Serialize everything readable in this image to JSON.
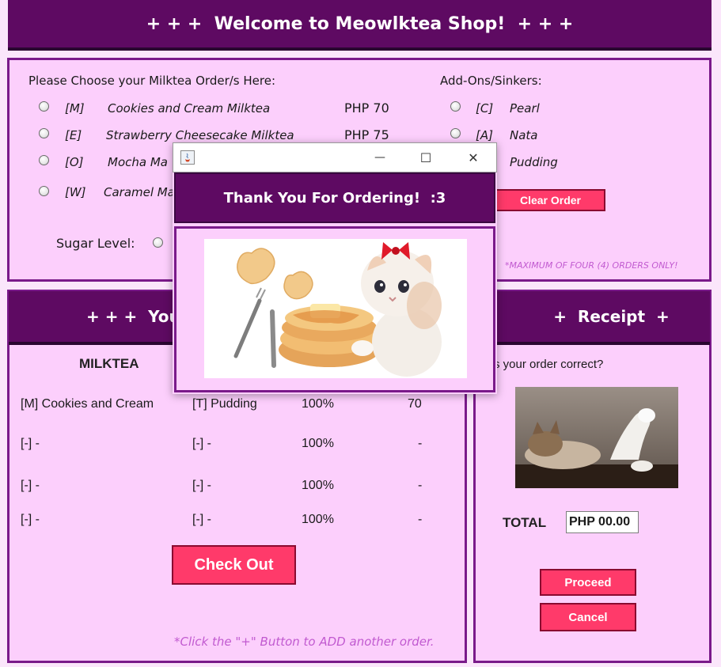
{
  "window_title": "+ + +  Welcome to Meowlktea Shop!  + + +",
  "order": {
    "heading": "Please Choose your Milktea Order/s Here:",
    "items": [
      {
        "code": "[M]",
        "name": "Cookies and Cream Milktea",
        "price": "PHP 70"
      },
      {
        "code": "[E]",
        "name": "Strawberry Cheesecake Milktea",
        "price": "PHP 75"
      },
      {
        "code": "[O]",
        "name": "Mocha Ma",
        "price": ""
      },
      {
        "code": "[W]",
        "name": "Caramel Ma",
        "price": ""
      }
    ],
    "sugar_label": "Sugar Level:"
  },
  "addons": {
    "heading": "Add-Ons/Sinkers:",
    "items": [
      {
        "code": "[C]",
        "name": "Pearl"
      },
      {
        "code": "[A]",
        "name": "Nata"
      },
      {
        "code": "",
        "name": "Pudding"
      }
    ],
    "clear_label": "Clear Order",
    "max_note": "*MAXIMUM OF FOUR (4) ORDERS ONLY!"
  },
  "your_order": {
    "header": "+ + +  Your",
    "col_milktea": "MILKTEA",
    "rows": [
      {
        "milktea": "[M] Cookies and Cream",
        "addon": "[T] Pudding",
        "sugar": "100%",
        "price": "70"
      },
      {
        "milktea": "[-] -",
        "addon": "[-] -",
        "sugar": "100%",
        "price": "-"
      },
      {
        "milktea": "[-] -",
        "addon": "[-] -",
        "sugar": "100%",
        "price": "-"
      },
      {
        "milktea": "[-] -",
        "addon": "[-] -",
        "sugar": "100%",
        "price": "-"
      }
    ],
    "checkout_label": "Check Out",
    "add_note": "*Click the \"+\" Button to ADD another order."
  },
  "receipt": {
    "header": "+  Receipt  +",
    "question": "s your order correct?",
    "total_label": "TOTAL",
    "total_value": "PHP 00.00",
    "proceed_label": "Proceed",
    "cancel_label": "Cancel"
  },
  "dialog": {
    "banner": "Thank You For Ordering!  :3",
    "minimize_glyph": "—",
    "maximize_glyph": "☐",
    "close_glyph": "✕"
  },
  "colors": {
    "header_purple": "#5e0a62",
    "panel_pink": "#fccffc",
    "button_pink": "#ff3a6a",
    "note_purple": "#c15ad0"
  }
}
